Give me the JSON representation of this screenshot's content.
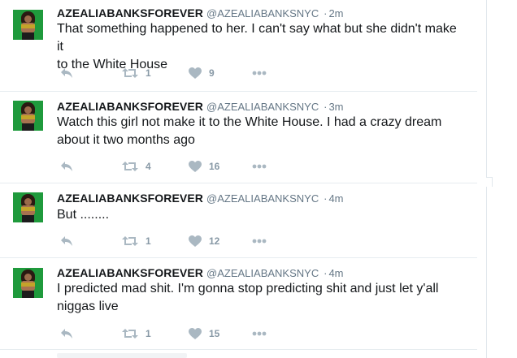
{
  "tweets": [
    {
      "fullname": "AZEALIABANKSFOREVER",
      "username": "@AZEALIABANKSNYC",
      "separator": "·",
      "time": "2m",
      "line1": "That something happened to her. I can't say what but she didn't make it",
      "line2": "to the White House",
      "retweets": "1",
      "likes": "9"
    },
    {
      "fullname": "AZEALIABANKSFOREVER",
      "username": "@AZEALIABANKSNYC",
      "separator": "·",
      "time": "3m",
      "line1": "Watch this girl not make it to the White House. I had a crazy dream",
      "line2": "about it two months ago",
      "retweets": "4",
      "likes": "16"
    },
    {
      "fullname": "AZEALIABANKSFOREVER",
      "username": "@AZEALIABANKSNYC",
      "separator": "·",
      "time": "4m",
      "line1": "But ........",
      "line2": "",
      "retweets": "1",
      "likes": "12"
    },
    {
      "fullname": "AZEALIABANKSFOREVER",
      "username": "@AZEALIABANKSNYC",
      "separator": "·",
      "time": "4m",
      "line1": "I predicted mad shit. I'm gonna stop predicting shit and just let y'all",
      "line2": "niggas live",
      "retweets": "1",
      "likes": "15"
    }
  ],
  "icons": {
    "reply": "reply-icon",
    "retweet": "retweet-icon",
    "like": "heart-icon",
    "more": "more-dots-icon"
  },
  "colors": {
    "text": "#14171a",
    "muted": "#657786",
    "icon": "#aab8c2",
    "divider": "#e6ecf0",
    "avatar_bg": "#1f9a3c"
  }
}
